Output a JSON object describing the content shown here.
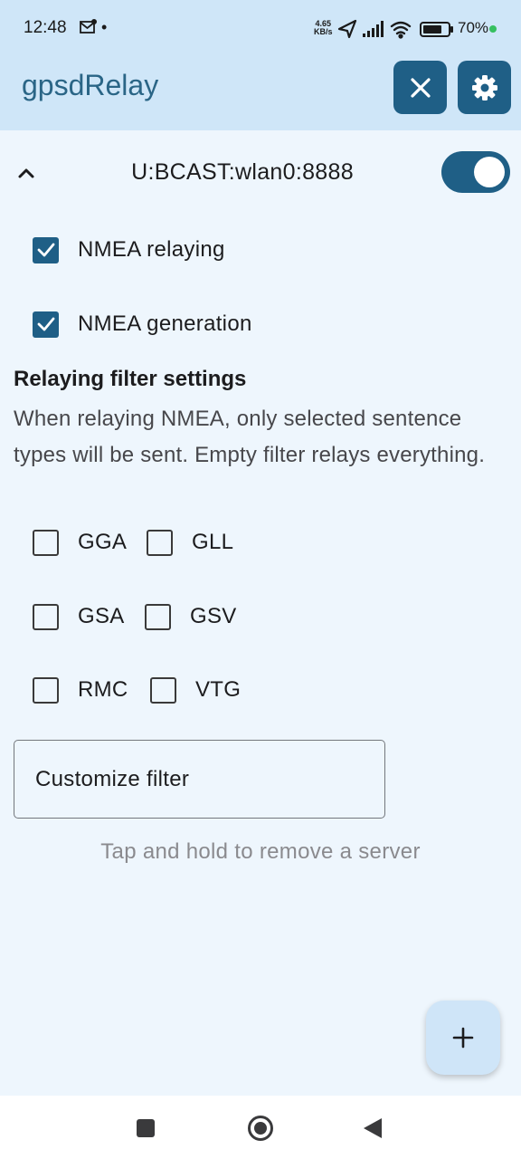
{
  "status_bar": {
    "time": "12:48",
    "dot": "•",
    "net_speed_value": "4.65",
    "net_speed_unit": "KB/s",
    "battery_percent": "70%"
  },
  "app_bar": {
    "title": "gpsdRelay"
  },
  "server": {
    "name": "U:BCAST:wlan0:8888",
    "enabled": true
  },
  "options": {
    "relaying_label": "NMEA relaying",
    "generation_label": "NMEA generation"
  },
  "filter": {
    "title": "Relaying filter settings",
    "description": "When relaying NMEA, only selected sentence types will be sent. Empty filter relays everything.",
    "sentences": [
      "GGA",
      "GLL",
      "GSA",
      "GSV",
      "RMC",
      "VTG"
    ],
    "customize_label": "Customize filter"
  },
  "hint": "Tap and hold to remove a server",
  "icons": {
    "close": "close-icon",
    "settings": "gear-icon",
    "add": "plus-icon"
  },
  "colors": {
    "accent": "#1f5f86",
    "header_bg": "#cfe6f8",
    "page_bg": "#eef6fd",
    "title_text": "#2a6586"
  }
}
